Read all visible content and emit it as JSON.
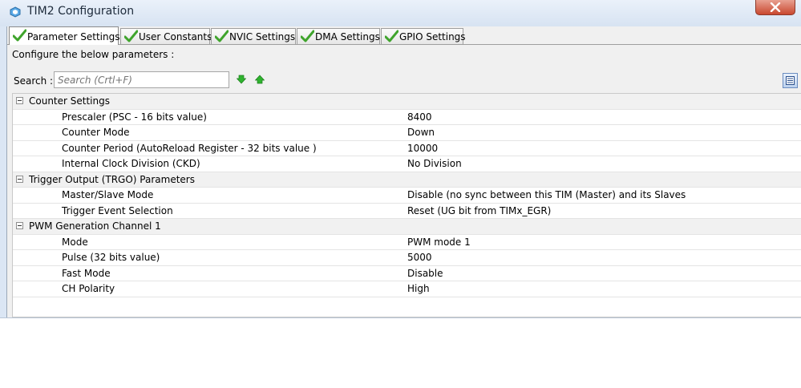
{
  "window": {
    "title": "TIM2 Configuration",
    "icon": "gear-cube-icon",
    "close_icon": "close-icon"
  },
  "tabs": [
    {
      "label": "Parameter Settings",
      "active": true,
      "icon": "checkmark-icon"
    },
    {
      "label": "User Constants",
      "active": false,
      "icon": "checkmark-icon"
    },
    {
      "label": "NVIC Settings",
      "active": false,
      "icon": "checkmark-icon"
    },
    {
      "label": "DMA Settings",
      "active": false,
      "icon": "checkmark-icon"
    },
    {
      "label": "GPIO Settings",
      "active": false,
      "icon": "checkmark-icon"
    }
  ],
  "panel": {
    "configure_text": "Configure the below parameters :",
    "search_label": "Search :",
    "search_placeholder": "Search (Crtl+F)",
    "search_value": ""
  },
  "groups": [
    {
      "label": "Counter Settings",
      "params": [
        {
          "name": "Prescaler (PSC - 16 bits value)",
          "value": "8400"
        },
        {
          "name": "Counter Mode",
          "value": "Down"
        },
        {
          "name": "Counter Period (AutoReload Register - 32 bits value )",
          "value": "10000"
        },
        {
          "name": "Internal Clock Division (CKD)",
          "value": "No Division"
        }
      ]
    },
    {
      "label": "Trigger Output (TRGO) Parameters",
      "params": [
        {
          "name": "Master/Slave Mode",
          "value": "Disable (no sync between this TIM (Master) and its Slaves"
        },
        {
          "name": "Trigger Event Selection",
          "value": "Reset (UG bit from TIMx_EGR)"
        }
      ]
    },
    {
      "label": "PWM Generation Channel 1",
      "params": [
        {
          "name": "Mode",
          "value": "PWM mode 1"
        },
        {
          "name": "Pulse (32 bits value)",
          "value": "5000"
        },
        {
          "name": "Fast Mode",
          "value": "Disable"
        },
        {
          "name": "CH Polarity",
          "value": "High"
        }
      ]
    }
  ],
  "colors": {
    "check_green": "#3fa42c",
    "arrow_green": "#2fb32f",
    "close_red": "#c9482f"
  }
}
